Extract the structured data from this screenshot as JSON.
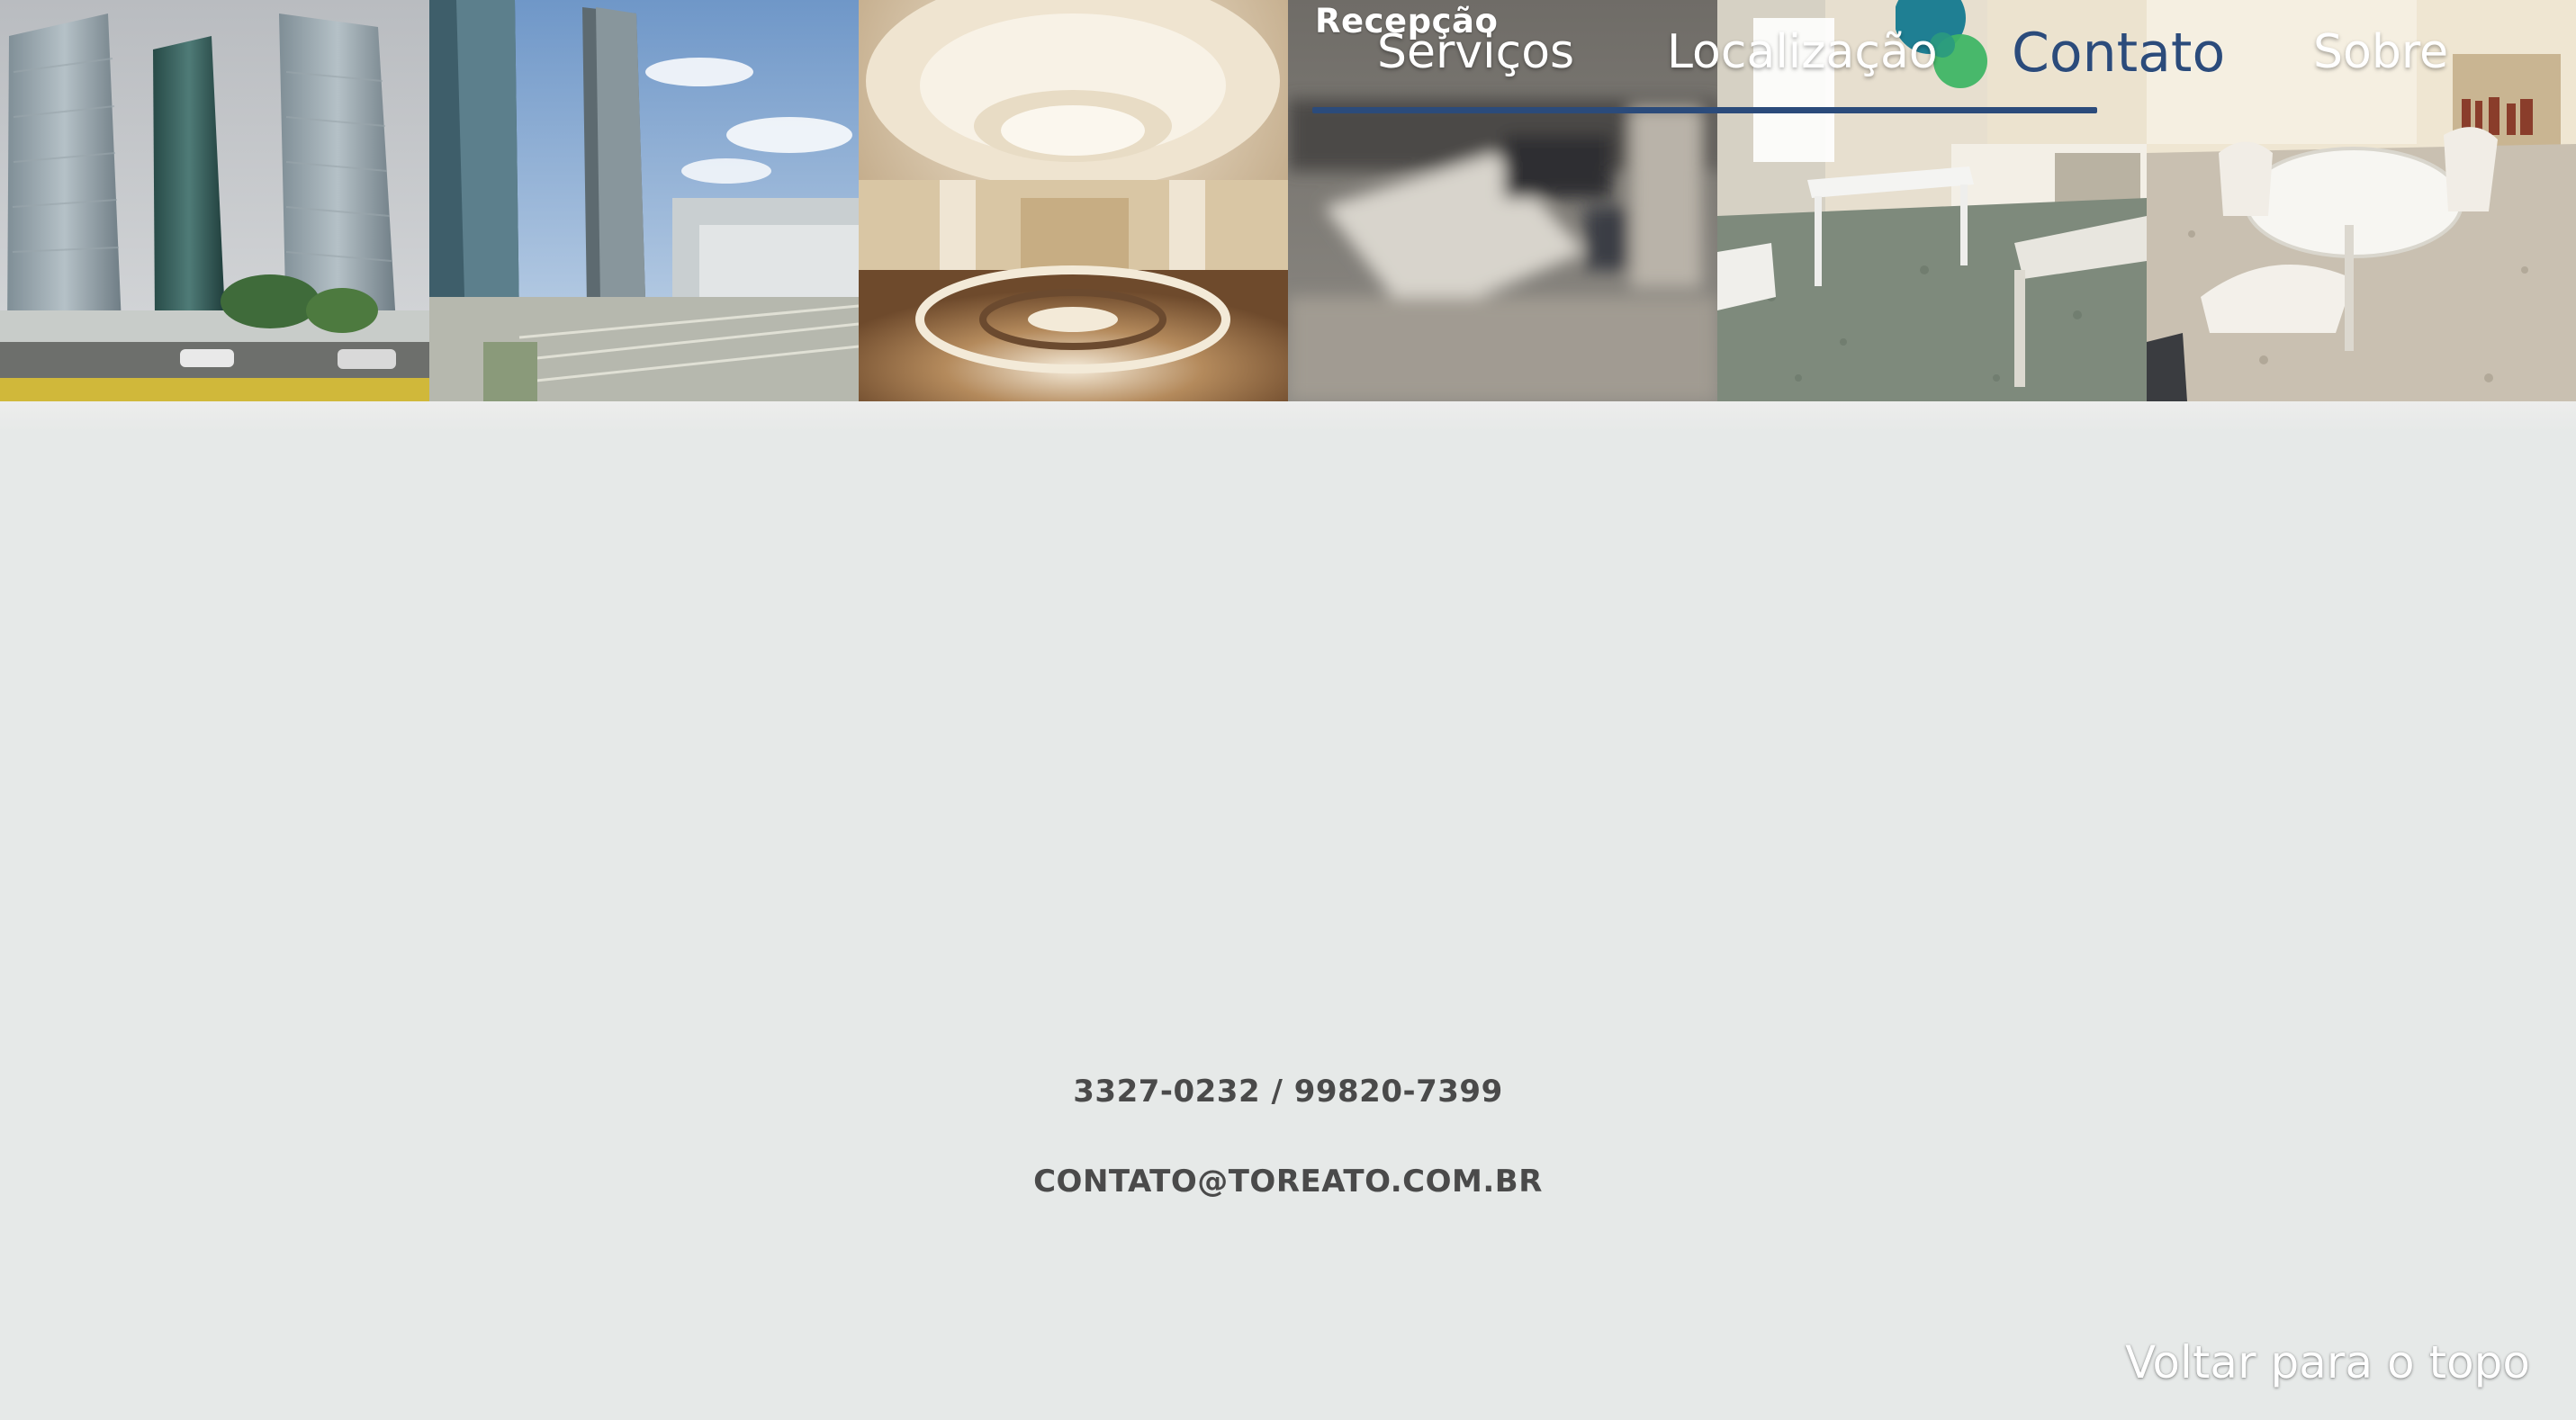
{
  "photos": [
    {
      "name": "towers-exterior"
    },
    {
      "name": "towers-aerial"
    },
    {
      "name": "lobby-hall"
    },
    {
      "name": "reception",
      "caption": "Recepção"
    },
    {
      "name": "office-room"
    },
    {
      "name": "meeting-room"
    }
  ],
  "nav": {
    "items": [
      {
        "id": "servicos",
        "label": "Serviços"
      },
      {
        "id": "localizacao",
        "label": "Localização"
      },
      {
        "id": "contato",
        "label": "Contato",
        "active": true
      },
      {
        "id": "sobre",
        "label": "Sobre"
      }
    ],
    "logo_icon": "overlapping-circles-logo"
  },
  "contact": {
    "phones": "3327-0232 / 99820-7399",
    "email": "CONTATO@TOREATO.COM.BR"
  },
  "footer": {
    "back_to_top": "Voltar para o topo"
  },
  "colors": {
    "accent": "#2b4b7b",
    "background": "#e6e9e8",
    "text": "#4a4a4a",
    "logo_teal": "#1f7f93",
    "logo_green": "#3fb565"
  }
}
